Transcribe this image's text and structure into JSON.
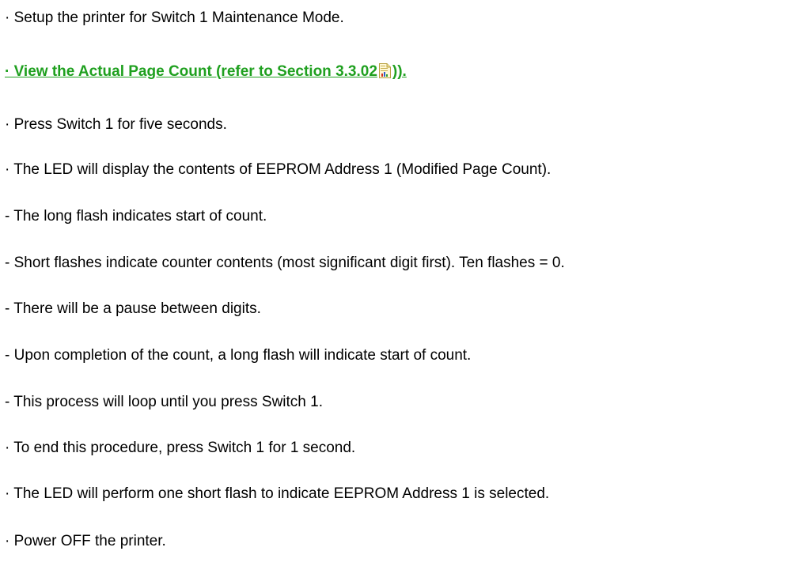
{
  "lines": [
    "· Setup the printer for Switch 1 Maintenance Mode.",
    "· Press Switch 1 for five seconds.",
    "· The LED will display the contents of EEPROM Address 1 (Modified Page Count).",
    "- The long flash indicates start of count.",
    "- Short flashes indicate counter contents (most significant digit first). Ten flashes = 0.",
    "- There will be a pause between digits.",
    "- Upon completion of the count, a long flash will indicate start of count.",
    "- This process will loop until you press Switch 1.",
    "· To end this procedure, press Switch 1 for 1 second.",
    "· The LED will perform one short flash to indicate EEPROM Address 1 is selected.",
    "· Power OFF the printer."
  ],
  "link": {
    "text_before_icon": "· View the Actual Page Count (refer to Section 3.3.02",
    "text_after_icon": ")).",
    "icon": "document-chart-icon",
    "color": "#1fa01f"
  }
}
